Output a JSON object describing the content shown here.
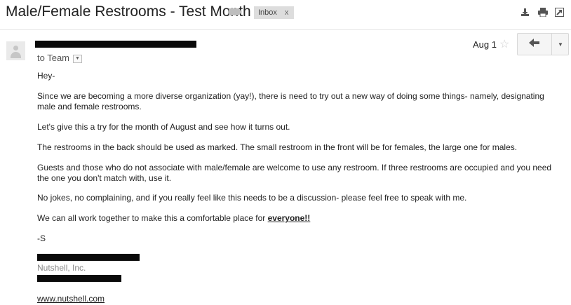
{
  "email": {
    "subject": "Male/Female Restrooms - Test Month",
    "label": "Inbox",
    "label_close": "x",
    "date": "Aug 1",
    "to": "to Team",
    "greeting": "Hey-",
    "paragraphs": [
      "Since we are becoming a more diverse organization (yay!), there is need to try out a new way of doing some things- namely, designating male and female restrooms.",
      "Let's give this a try for the month of August and see how it turns out.",
      "The restrooms in the back should be used as marked.  The small restroom in the front will be for females, the large one for males.",
      "Guests and those who do not associate with male/female are welcome to use any restroom. If three restrooms are occupied and you need the one you don't match with, use it.",
      "No jokes, no complaining, and if you really feel like this needs to be a discussion- please feel free to speak with me."
    ],
    "closing_prefix": "We can all work together to make this a comfortable place for ",
    "closing_emphasis": "everyone!!",
    "signoff": "-S",
    "company": "Nutshell, Inc.",
    "website": "www.nutshell.com"
  },
  "icons": {
    "label": "label-icon",
    "download": "download-icon",
    "print": "print-icon",
    "new_window": "new-window-icon",
    "star": "star-icon",
    "reply": "reply-icon",
    "more": "chevron-down-icon",
    "avatar": "avatar-icon"
  },
  "colors": {
    "redaction": "#0a0a0a",
    "badge": "#dddddd"
  }
}
